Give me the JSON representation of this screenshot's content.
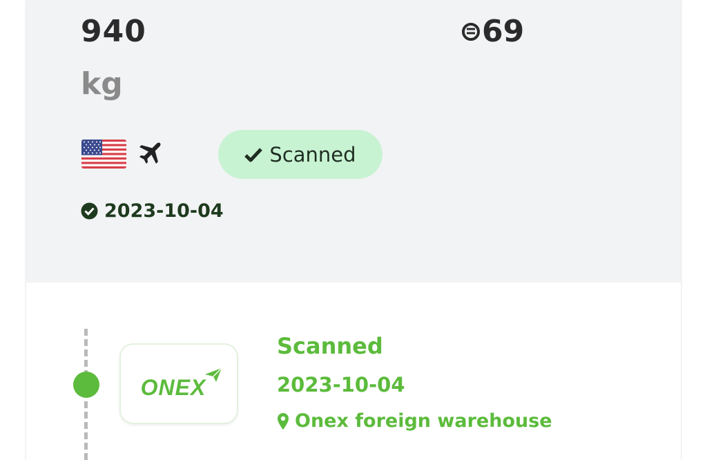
{
  "package": {
    "weight_value": "940",
    "weight_unit": "kg",
    "price_value": "69",
    "price_icon": "currency-icon",
    "origin_country_icon": "us-flag-icon",
    "shipping_method_icon": "airplane-icon",
    "status_label": "Scanned",
    "status_icon": "check-icon",
    "scan_date": "2023-10-04"
  },
  "timeline": {
    "events": [
      {
        "logo_text": "ONEX",
        "status": "Scanned",
        "date": "2023-10-04",
        "location": "Onex foreign warehouse"
      }
    ]
  },
  "colors": {
    "summary_bg": "#f2f3f5",
    "badge_bg": "#c8f3d3",
    "accent_green": "#5cbb3c",
    "dark_text": "#2b2b2b",
    "muted_text": "#8a8a8a"
  }
}
